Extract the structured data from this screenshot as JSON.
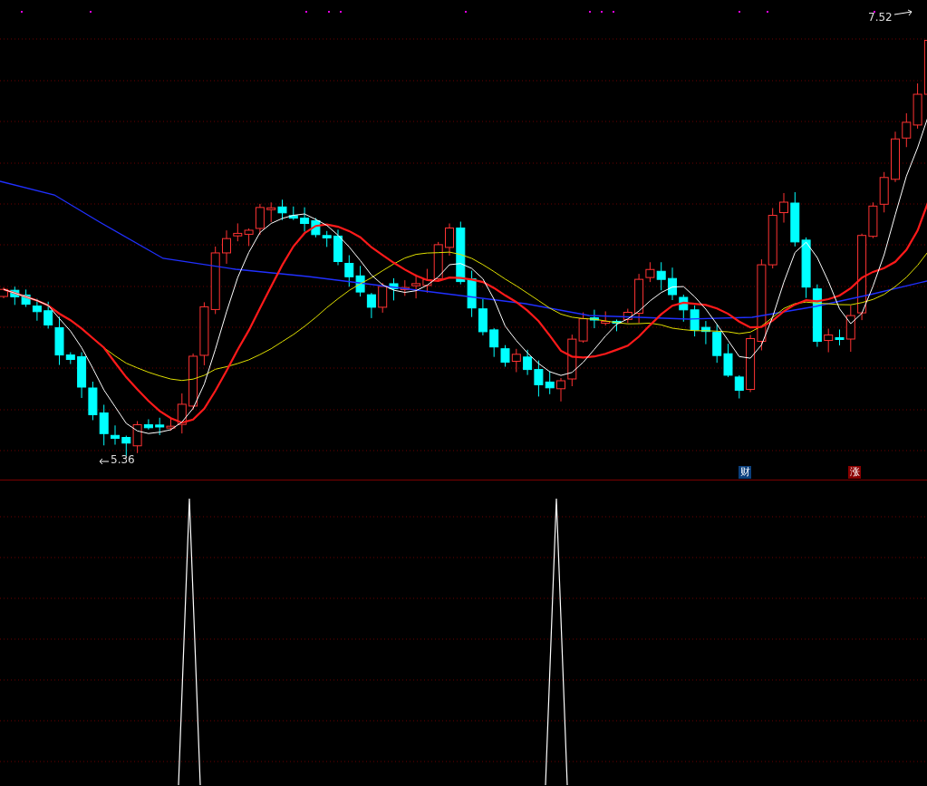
{
  "price_panel": {
    "high_label": "7.52",
    "low_label": "5.36",
    "markers": [
      {
        "text": "财",
        "color": "#0b3f7c"
      },
      {
        "text": "涨",
        "color": "#8a0000"
      }
    ]
  }
}
